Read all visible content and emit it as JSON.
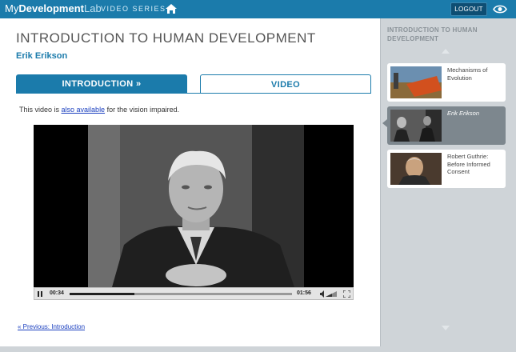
{
  "header": {
    "logo": {
      "my": "My",
      "dev": "Development",
      "lab": "Lab"
    },
    "series_label": "VIDEO SERIES",
    "home_icon": "home-icon",
    "logout_label": "LOGOUT",
    "eye_icon": "eye-icon"
  },
  "main": {
    "title": "INTRODUCTION TO HUMAN DEVELOPMENT",
    "subtitle": "Erik Erikson",
    "tabs": [
      {
        "label": "INTRODUCTION »"
      },
      {
        "label": "VIDEO"
      }
    ],
    "availability": {
      "prefix": "This video is ",
      "link": "also available",
      "suffix": " for the vision impaired."
    },
    "player": {
      "current_time": "00:34",
      "duration": "01:56",
      "progress_fraction": 0.29,
      "pause_icon": "pause-icon",
      "volume_icon": "volume-icon",
      "fullscreen_icon": "fullscreen-icon"
    },
    "prev_link": "« Previous:  Introduction"
  },
  "sidebar": {
    "title": "INTRODUCTION TO HUMAN DEVELOPMENT",
    "items": [
      {
        "label": "Mechanisms of Evolution",
        "active": false
      },
      {
        "label": "Erik Erikson",
        "active": true
      },
      {
        "label": "Robert Guthrie: Before Informed Consent",
        "active": false
      }
    ]
  },
  "colors": {
    "brand": "#1b7bab",
    "sidebar_bg": "#cfd4d8",
    "active_card": "#7d878e"
  }
}
